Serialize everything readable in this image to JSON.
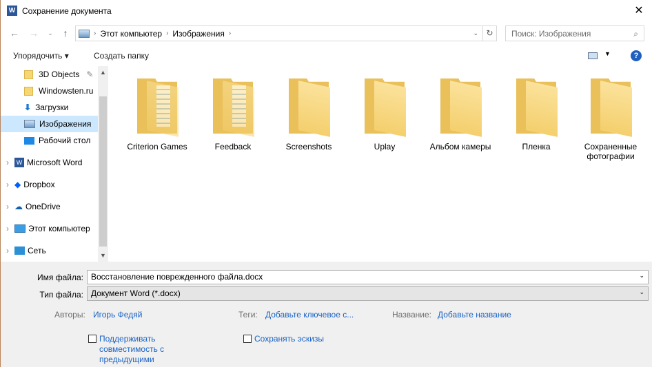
{
  "window": {
    "title": "Сохранение документа",
    "close": "✕"
  },
  "address": {
    "path": [
      "Этот компьютер",
      "Изображения"
    ],
    "search_placeholder": "Поиск: Изображения"
  },
  "toolbar": {
    "organize": "Упорядочить ▾",
    "new_folder": "Создать папку",
    "help": "?"
  },
  "nav": [
    {
      "label": "3D Objects",
      "type": "folder"
    },
    {
      "label": "Windowsten.ru",
      "type": "folder"
    },
    {
      "label": "Загрузки",
      "type": "download"
    },
    {
      "label": "Изображения",
      "type": "pictures",
      "selected": true
    },
    {
      "label": "Рабочий стол",
      "type": "desktop"
    },
    {
      "label": "Microsoft Word",
      "type": "word"
    },
    {
      "label": "Dropbox",
      "type": "dropbox"
    },
    {
      "label": "OneDrive",
      "type": "onedrive"
    },
    {
      "label": "Этот компьютер",
      "type": "pc"
    },
    {
      "label": "Сеть",
      "type": "network"
    }
  ],
  "folders": [
    "Criterion Games",
    "Feedback",
    "Screenshots",
    "Uplay",
    "Альбом камеры",
    "Пленка",
    "Сохраненные фотографии"
  ],
  "form": {
    "filename_label": "Имя файла:",
    "filename": "Восстановление поврежденного файла.docx",
    "filetype_label": "Тип файла:",
    "filetype": "Документ Word (*.docx)",
    "authors_label": "Авторы:",
    "authors": "Игорь Федяй",
    "tags_label": "Теги:",
    "tags": "Добавьте ключевое с...",
    "title_label": "Название:",
    "title": "Добавьте название",
    "compat": "Поддерживать совместимость с предыдущими",
    "thumbs": "Сохранять эскизы"
  }
}
